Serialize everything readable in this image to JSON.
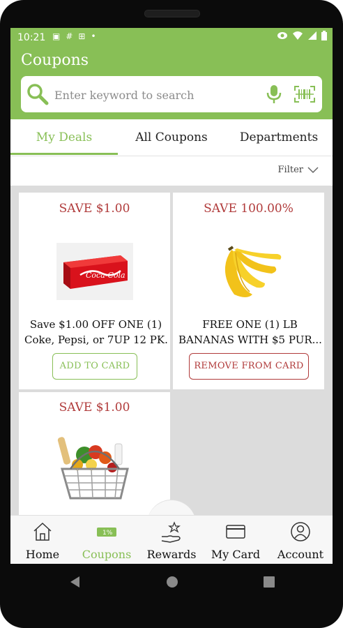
{
  "status": {
    "time": "10:21"
  },
  "header": {
    "title": "Coupons"
  },
  "search": {
    "placeholder": "Enter keyword to search"
  },
  "tabs": [
    {
      "label": "My Deals",
      "active": true
    },
    {
      "label": "All Coupons",
      "active": false
    },
    {
      "label": "Departments",
      "active": false
    }
  ],
  "filter": {
    "label": "Filter"
  },
  "coupons": [
    {
      "save": "SAVE $1.00",
      "desc_line1": "Save $1.00 OFF ONE (1)",
      "desc_line2": "Coke, Pepsi, or 7UP 12 PK...",
      "button": "ADD TO CARD",
      "image": "coca-cola-12-pack"
    },
    {
      "save": "SAVE 100.00%",
      "desc_line1": "FREE ONE (1) LB",
      "desc_line2": "BANANAS WITH $5 PUR...",
      "button": "REMOVE FROM CARD",
      "image": "bananas"
    },
    {
      "save": "SAVE $1.00",
      "image": "grocery-basket"
    }
  ],
  "nav": [
    {
      "label": "Home",
      "icon": "home-icon",
      "active": false
    },
    {
      "label": "Coupons",
      "icon": "coupon-icon",
      "active": true
    },
    {
      "label": "Rewards",
      "icon": "rewards-icon",
      "active": false
    },
    {
      "label": "My Card",
      "icon": "card-icon",
      "active": false
    },
    {
      "label": "Account",
      "icon": "account-icon",
      "active": false
    }
  ],
  "colors": {
    "brand": "#88bf56",
    "accent_red": "#b03a3a"
  }
}
